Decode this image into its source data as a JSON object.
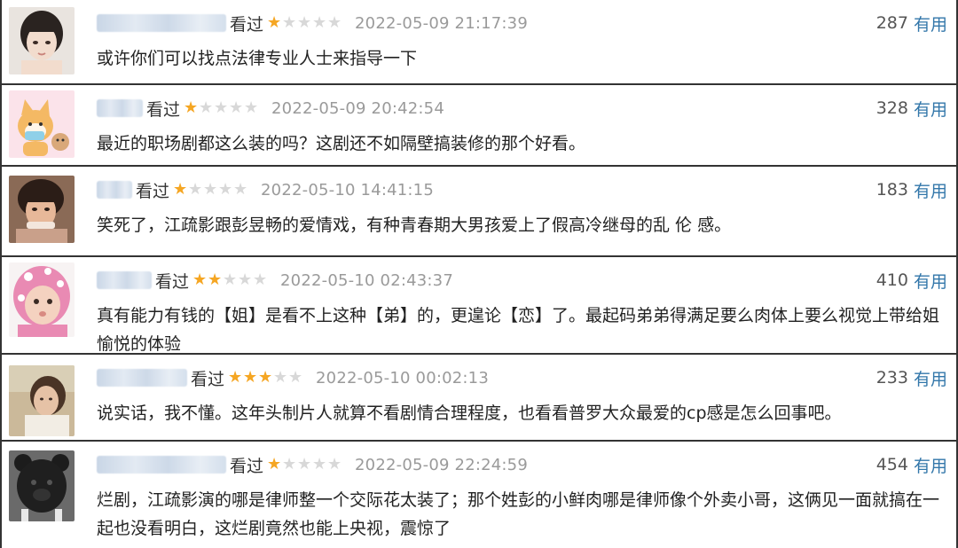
{
  "comments": [
    {
      "watched_label": "看过",
      "rating": 1,
      "date": "2022-05-09 21:17:39",
      "votes": "287",
      "useful_label": "有用",
      "text": "或许你们可以找点法律专业人士来指导一下",
      "avatar_icon": "girl-portrait-avatar"
    },
    {
      "watched_label": "看过",
      "rating": 1,
      "date": "2022-05-09 20:42:54",
      "votes": "328",
      "useful_label": "有用",
      "text": "最近的职场剧都这么装的吗？这剧还不如隔壁搞装修的那个好看。",
      "avatar_icon": "shiba-dog-cartoon-avatar"
    },
    {
      "watched_label": "看过",
      "rating": 1,
      "date": "2022-05-10 14:41:15",
      "votes": "183",
      "useful_label": "有用",
      "text": "笑死了，江疏影跟彭昱畅的爱情戏，有种青春期大男孩爱上了假高冷继母的乱 伦 感。",
      "avatar_icon": "person-photo-avatar"
    },
    {
      "watched_label": "看过",
      "rating": 2,
      "date": "2022-05-10 02:43:37",
      "votes": "410",
      "useful_label": "有用",
      "text": "真有能力有钱的【姐】是看不上这种【弟】的，更遑论【恋】了。最起码弟弟得满足要么肉体上要么视觉上带给姐愉悦的体验",
      "avatar_icon": "baby-pink-hat-avatar"
    },
    {
      "watched_label": "看过",
      "rating": 3,
      "date": "2022-05-10 00:02:13",
      "votes": "233",
      "useful_label": "有用",
      "text": "说实话，我不懂。这年头制片人就算不看剧情合理程度，也看看普罗大众最爱的cp感是怎么回事吧。",
      "avatar_icon": "woman-portrait-avatar"
    },
    {
      "watched_label": "看过",
      "rating": 1,
      "date": "2022-05-09 22:24:59",
      "votes": "454",
      "useful_label": "有用",
      "text": "烂剧，江疏影演的哪是律师整一个交际花太装了；那个姓彭的小鲜肉哪是律师像个外卖小哥，这俩见一面就搞在一起也没看明白，这烂剧竟然也能上央视，震惊了",
      "avatar_icon": "dark-bear-avatar"
    }
  ],
  "colors": {
    "star_on": "#f5a623",
    "star_off": "#d8d8d8",
    "link": "#3377aa",
    "date": "#9a9a9a",
    "border": "#333333"
  }
}
